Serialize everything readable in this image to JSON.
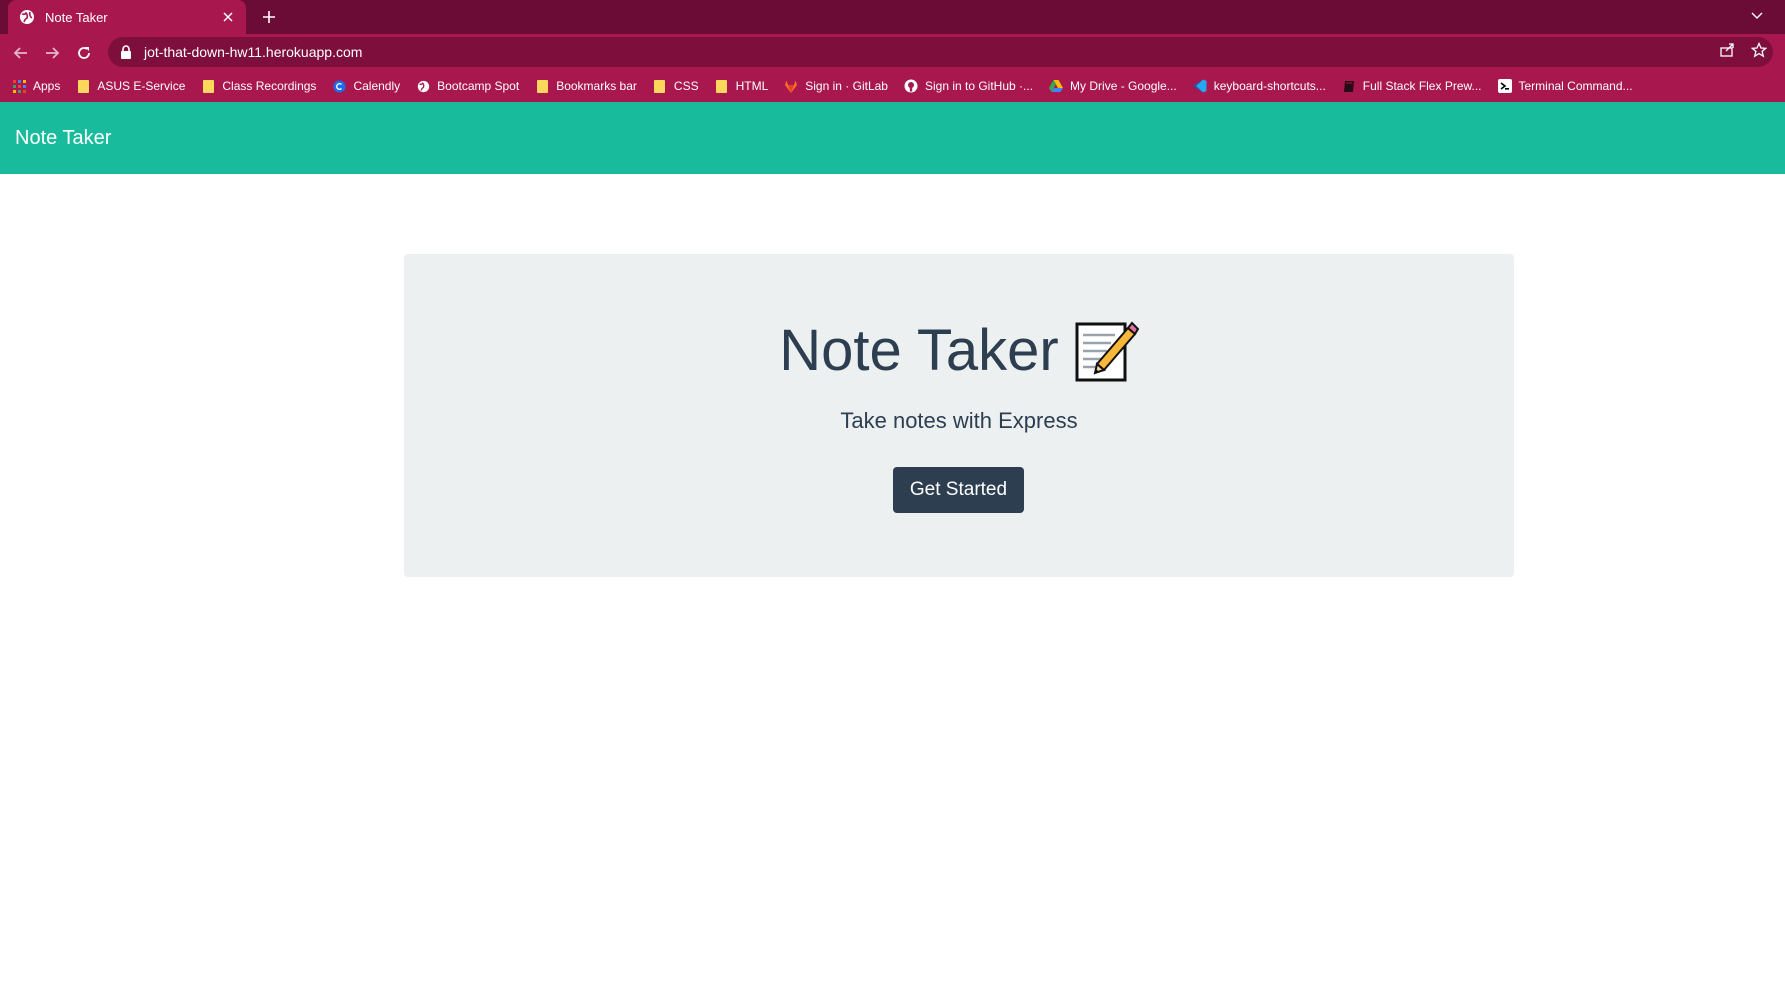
{
  "browser": {
    "tab_title": "Note Taker",
    "url": "jot-that-down-hw11.herokuapp.com",
    "bookmarks": [
      {
        "label": "Apps",
        "icon": "apps-grid-icon"
      },
      {
        "label": "ASUS E-Service",
        "icon": "folder-icon"
      },
      {
        "label": "Class Recordings",
        "icon": "folder-icon"
      },
      {
        "label": "Calendly",
        "icon": "calendly-icon"
      },
      {
        "label": "Bootcamp Spot",
        "icon": "globe-icon"
      },
      {
        "label": "Bookmarks bar",
        "icon": "folder-icon"
      },
      {
        "label": "CSS",
        "icon": "folder-icon"
      },
      {
        "label": "HTML",
        "icon": "folder-icon"
      },
      {
        "label": "Sign in · GitLab",
        "icon": "gitlab-icon"
      },
      {
        "label": "Sign in to GitHub ·...",
        "icon": "github-icon"
      },
      {
        "label": "My Drive - Google...",
        "icon": "google-drive-icon"
      },
      {
        "label": "keyboard-shortcuts...",
        "icon": "vscode-icon"
      },
      {
        "label": "Full Stack Flex Prew...",
        "icon": "book-icon"
      },
      {
        "label": "Terminal Command...",
        "icon": "terminal-icon"
      }
    ]
  },
  "navbar": {
    "brand": "Note Taker"
  },
  "hero": {
    "title": "Note Taker",
    "subtitle": "Take notes with Express",
    "button_label": "Get Started"
  },
  "colors": {
    "tabstrip": "#6b0c37",
    "chrome": "#a8184f",
    "navbar": "#18bc9c",
    "jumbotron": "#ecf0f1",
    "primary_button": "#2c3e50"
  }
}
